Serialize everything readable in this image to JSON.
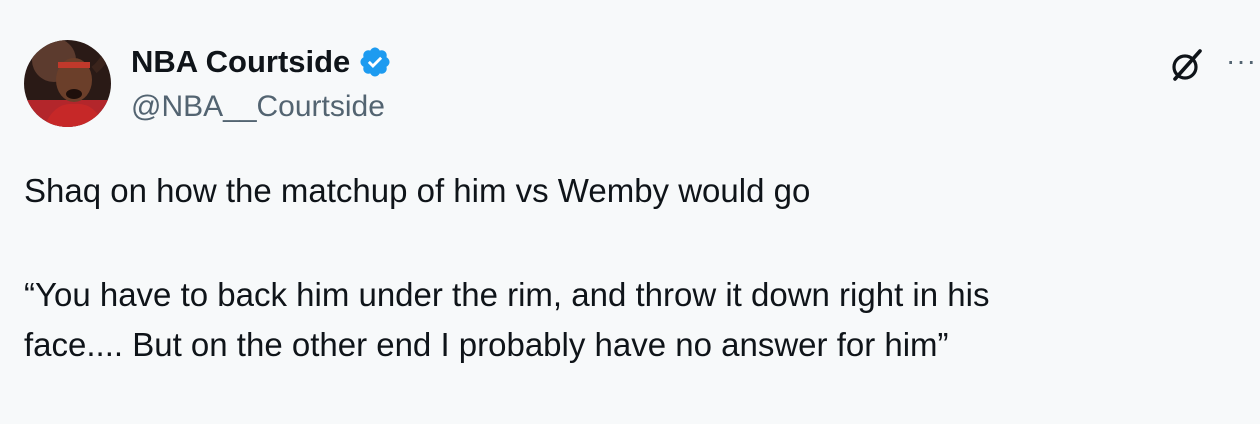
{
  "author": {
    "display_name": "NBA Courtside",
    "handle": "@NBA__Courtside",
    "verified_color": "#1d9bf0",
    "avatar_icon": "player-avatar"
  },
  "actions": {
    "grok_icon": "grok-icon",
    "more_label": "···"
  },
  "tweet": {
    "line1": "Shaq on how the matchup of him vs Wemby would go",
    "quote_line1": "“You have to back him under the rim, and throw it down right in his",
    "quote_line2": "face.... But on the other end I probably have no answer for him”"
  }
}
